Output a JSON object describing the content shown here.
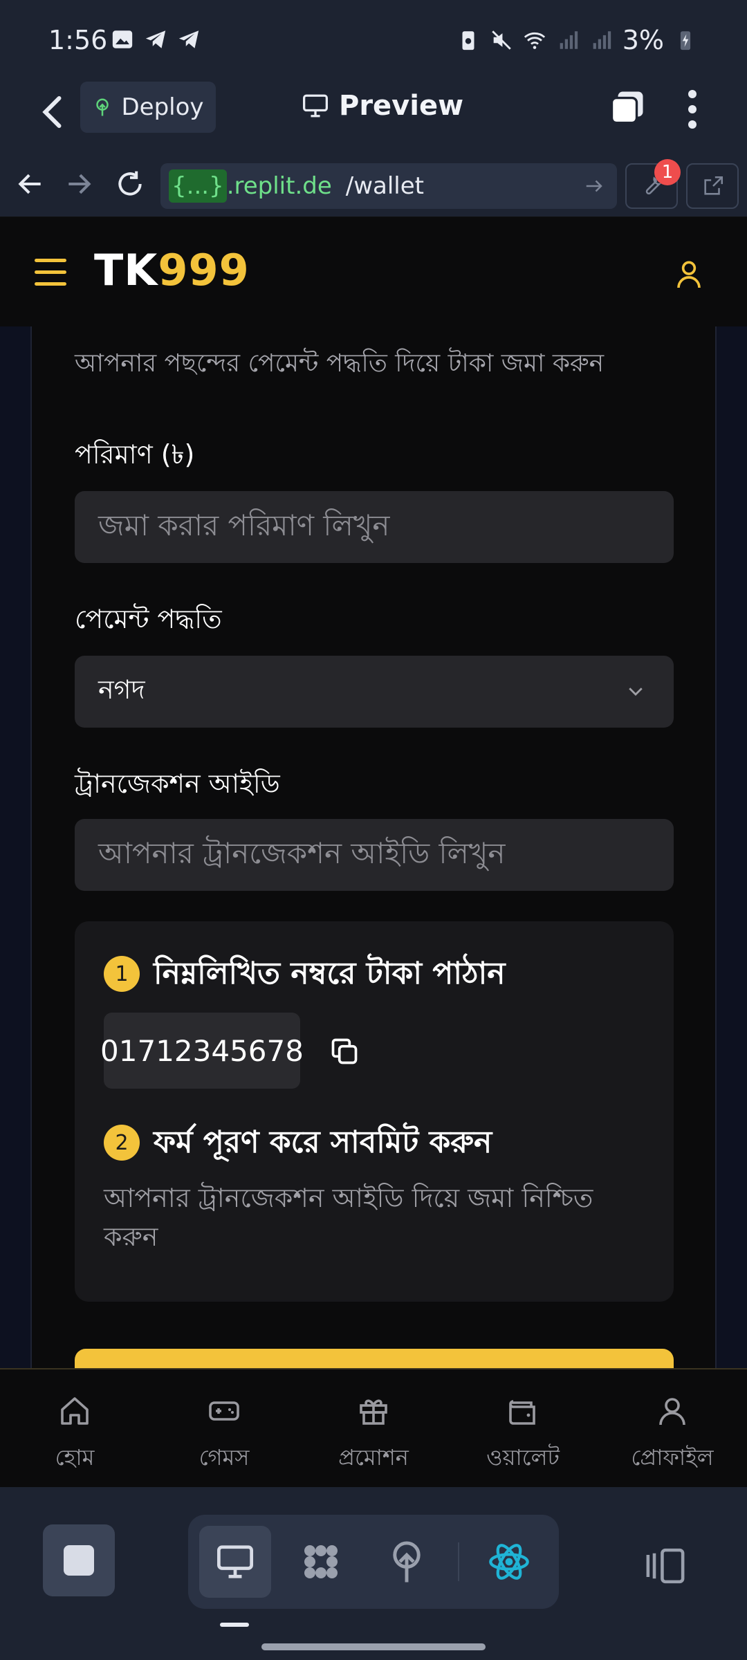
{
  "status_bar": {
    "time": "1:56",
    "battery": "3%"
  },
  "top_bar": {
    "deploy_label": "Deploy",
    "preview_label": "Preview"
  },
  "url_bar": {
    "brace": "{...}",
    "host": ".replit.de",
    "path": "/wallet",
    "devtools_badge": "1"
  },
  "app_header": {
    "brand_prefix": "TK",
    "brand_suffix": "999"
  },
  "form": {
    "subtitle": "আপনার পছন্দের পেমেন্ট পদ্ধতি দিয়ে টাকা জমা করুন",
    "amount_label": "পরিমাণ (৳)",
    "amount_placeholder": "জমা করার পরিমাণ লিখুন",
    "method_label": "পেমেন্ট পদ্ধতি",
    "method_value": "নগদ",
    "txn_label": "ট্রানজেকশন আইডি",
    "txn_placeholder": "আপনার ট্রানজেকশন আইডি লিখুন"
  },
  "instructions": {
    "step1_num": "1",
    "step1_title": "নিম্নলিখিত নম্বরে টাকা পাঠান",
    "phone_number": "01712345678",
    "step2_num": "2",
    "step2_title": "ফর্ম পূরণ করে সাবমিট করুন",
    "step2_desc": "আপনার ট্রানজেকশন আইডি দিয়ে জমা নিশ্চিত করুন"
  },
  "bottom_nav": {
    "home": "হোম",
    "games": "গেমস",
    "promotion": "প্রমোশন",
    "wallet": "ওয়ালেট",
    "profile": "প্রোফাইল"
  },
  "colors": {
    "accent": "#f3c33b",
    "background": "#0b0b0c",
    "replit_bg": "#1d2331"
  }
}
